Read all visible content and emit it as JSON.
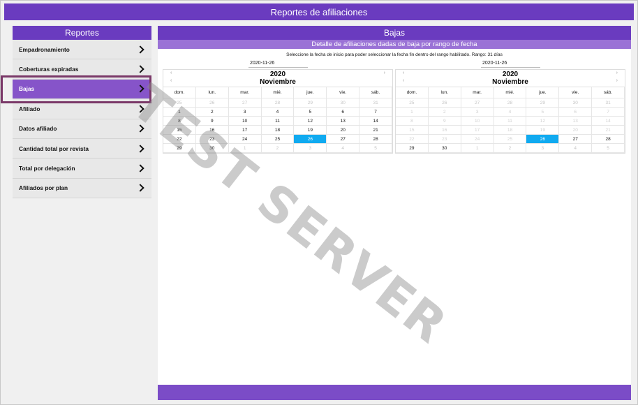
{
  "topbar": {
    "title": "Reportes de afiliaciones"
  },
  "sidebar": {
    "header": "Reportes",
    "items": [
      {
        "label": "Empadronamiento",
        "active": false,
        "name": "sidebar-item-empadronamiento"
      },
      {
        "label": "Coberturas expiradas",
        "active": false,
        "name": "sidebar-item-coberturas-expiradas"
      },
      {
        "label": "Bajas",
        "active": true,
        "name": "sidebar-item-bajas"
      },
      {
        "label": "Afiliado",
        "active": false,
        "name": "sidebar-item-afiliado"
      },
      {
        "label": "Datos afiliado",
        "active": false,
        "name": "sidebar-item-datos-afiliado"
      },
      {
        "label": "Cantidad total por revista",
        "active": false,
        "name": "sidebar-item-cantidad-total-por-revista"
      },
      {
        "label": "Total por delegación",
        "active": false,
        "name": "sidebar-item-total-por-delegacion"
      },
      {
        "label": "Afiliados por plan",
        "active": false,
        "name": "sidebar-item-afiliados-por-plan"
      }
    ]
  },
  "main": {
    "title": "Bajas",
    "subtitle": "Detalle de afiliaciones dadas de baja por rango de fecha",
    "instructions": "Seleccione la fecha de inicio para poder seleccionar la fecha fin dentro del rango habilitado. Rango: 31 días",
    "start_date": "2020-11-26",
    "end_date": "2020-11-26"
  },
  "calendar": {
    "year": "2020",
    "month": "Noviembre",
    "prev_year": "‹",
    "next_year": "›",
    "prev_month": "‹",
    "weekdays": [
      "dom.",
      "lun.",
      "mar.",
      "mié.",
      "jue.",
      "vie.",
      "sáb."
    ],
    "days": [
      [
        "25",
        "26",
        "27",
        "28",
        "29",
        "30",
        "31"
      ],
      [
        "1",
        "2",
        "3",
        "4",
        "5",
        "6",
        "7"
      ],
      [
        "8",
        "9",
        "10",
        "11",
        "12",
        "13",
        "14"
      ],
      [
        "15",
        "16",
        "17",
        "18",
        "19",
        "20",
        "21"
      ],
      [
        "22",
        "23",
        "24",
        "25",
        "26",
        "27",
        "28"
      ],
      [
        "29",
        "30",
        "1",
        "2",
        "3",
        "4",
        "5"
      ]
    ],
    "selected": "26"
  },
  "watermark": "TEST SERVER",
  "colors": {
    "primary": "#6a3bbf",
    "subheader": "#9a72d6",
    "active_item": "#8654c9",
    "selected_day": "#10aaf0",
    "highlight_border": "#7a3868"
  }
}
